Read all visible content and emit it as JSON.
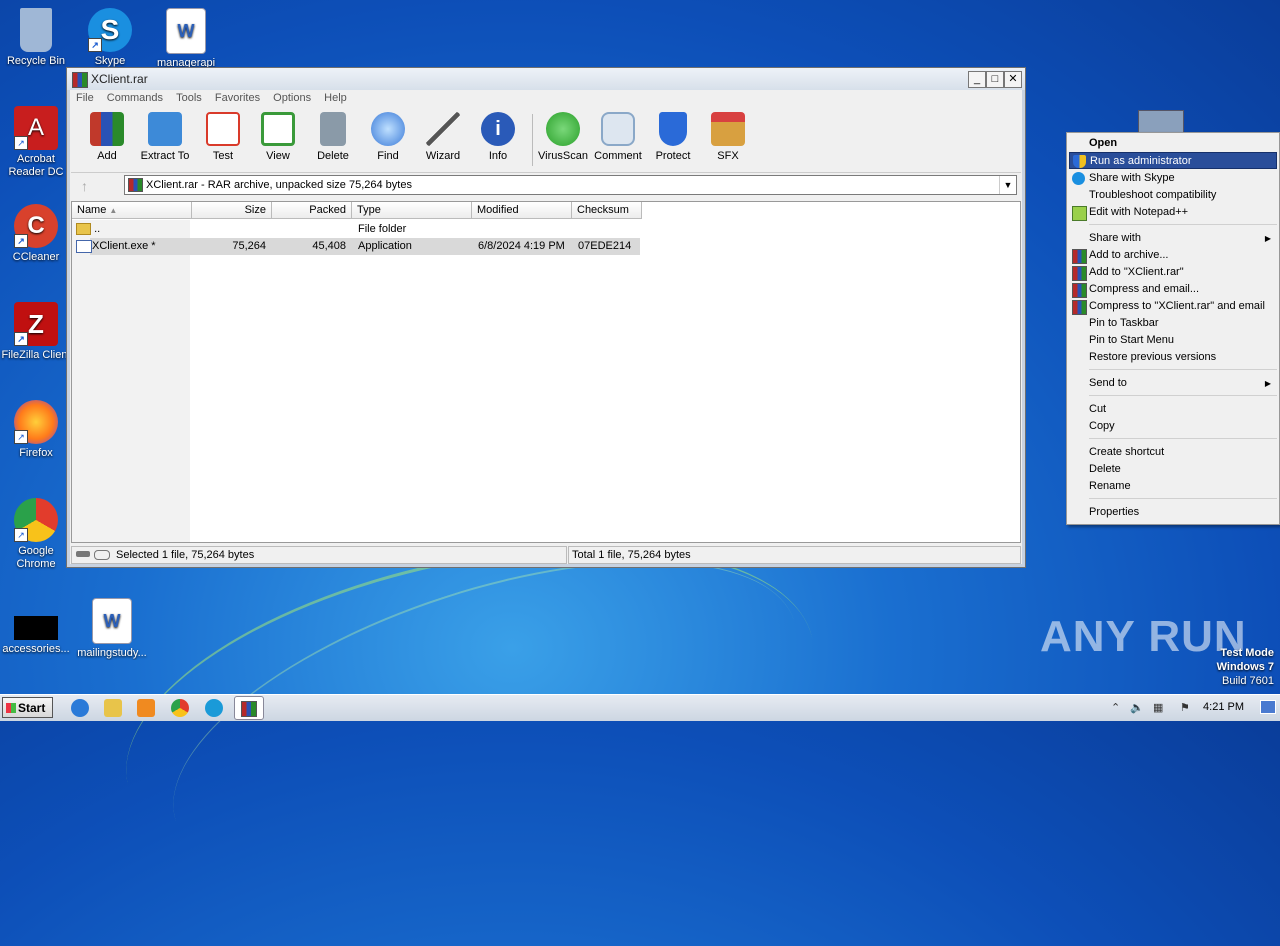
{
  "desktop": {
    "icons": [
      {
        "label": "Recycle Bin",
        "color": "#9fb7d6"
      },
      {
        "label": "Skype",
        "color": "#1a8fe0"
      },
      {
        "label": "managerapi",
        "color": "#2b5fb8"
      },
      {
        "label": "Acrobat Reader DC",
        "color": "#c81e1e"
      },
      {
        "label": "CCleaner",
        "color": "#d8412c"
      },
      {
        "label": "FileZilla Client",
        "color": "#c01010"
      },
      {
        "label": "Firefox",
        "color": "#ff7a1a"
      },
      {
        "label": "Google Chrome",
        "color": "#2aa14a"
      },
      {
        "label": "accessories...",
        "color": "#000000"
      },
      {
        "label": "mailingstudy...",
        "color": "#2b5fb8"
      }
    ]
  },
  "window": {
    "title": "XClient.rar",
    "menu": [
      "File",
      "Commands",
      "Tools",
      "Favorites",
      "Options",
      "Help"
    ],
    "toolbar": [
      {
        "label": "Add",
        "icon": "add-archive-icon",
        "color": "#c0392b"
      },
      {
        "label": "Extract To",
        "icon": "extract-folder-icon",
        "color": "#3d8ad8"
      },
      {
        "label": "Test",
        "icon": "test-checklist-icon",
        "color": "#d93a2a"
      },
      {
        "label": "View",
        "icon": "view-book-icon",
        "color": "#3a9a3a"
      },
      {
        "label": "Delete",
        "icon": "delete-trash-icon",
        "color": "#8a9aa8"
      },
      {
        "label": "Find",
        "icon": "find-magnifier-icon",
        "color": "#3a7ad8"
      },
      {
        "label": "Wizard",
        "icon": "wizard-wand-icon",
        "color": "#9ad04a"
      },
      {
        "label": "Info",
        "icon": "info-icon",
        "color": "#2a5ab8"
      },
      {
        "label": "VirusScan",
        "icon": "virusscan-bug-icon",
        "color": "#2aa02a"
      },
      {
        "label": "Comment",
        "icon": "comment-icon",
        "color": "#8aa8c8"
      },
      {
        "label": "Protect",
        "icon": "protect-shield-icon",
        "color": "#2a6ad8"
      },
      {
        "label": "SFX",
        "icon": "sfx-box-icon",
        "color": "#d8a040"
      }
    ],
    "address": "XClient.rar - RAR archive, unpacked size 75,264 bytes",
    "columns": [
      "Name",
      "Size",
      "Packed",
      "Type",
      "Modified",
      "Checksum"
    ],
    "rows": [
      {
        "name": "..",
        "size": "",
        "packed": "",
        "type": "File folder",
        "modified": "",
        "checksum": ""
      },
      {
        "name": "XClient.exe *",
        "size": "75,264",
        "packed": "45,408",
        "type": "Application",
        "modified": "6/8/2024 4:19 PM",
        "checksum": "07EDE214"
      }
    ],
    "status_left": "Selected 1 file, 75,264 bytes",
    "status_right": "Total 1 file, 75,264 bytes"
  },
  "context_menu": {
    "items": [
      {
        "label": "Open",
        "bold": true
      },
      {
        "label": "Run as administrator",
        "highlighted": true,
        "icon": "uac-shield-icon"
      },
      {
        "label": "Share with Skype",
        "icon": "skype-icon"
      },
      {
        "label": "Troubleshoot compatibility"
      },
      {
        "label": "Edit with Notepad++",
        "icon": "notepadpp-icon"
      },
      {
        "label": "Share with",
        "submenu": true
      },
      {
        "label": "Add to archive...",
        "icon": "winrar-icon"
      },
      {
        "label": "Add to \"XClient.rar\"",
        "icon": "winrar-icon"
      },
      {
        "label": "Compress and email...",
        "icon": "winrar-icon"
      },
      {
        "label": "Compress to \"XClient.rar\" and email",
        "icon": "winrar-icon"
      },
      {
        "label": "Pin to Taskbar"
      },
      {
        "label": "Pin to Start Menu"
      },
      {
        "label": "Restore previous versions"
      },
      {
        "label": "Send to",
        "submenu": true
      },
      {
        "label": "Cut"
      },
      {
        "label": "Copy"
      },
      {
        "label": "Create shortcut"
      },
      {
        "label": "Delete"
      },
      {
        "label": "Rename"
      },
      {
        "label": "Properties"
      }
    ]
  },
  "taskbar": {
    "start_label": "Start",
    "clock": "4:21 PM"
  },
  "watermark": {
    "line1": "Test Mode",
    "line2": "Windows 7",
    "line3": "Build 7601",
    "brand": "ANY RUN"
  }
}
